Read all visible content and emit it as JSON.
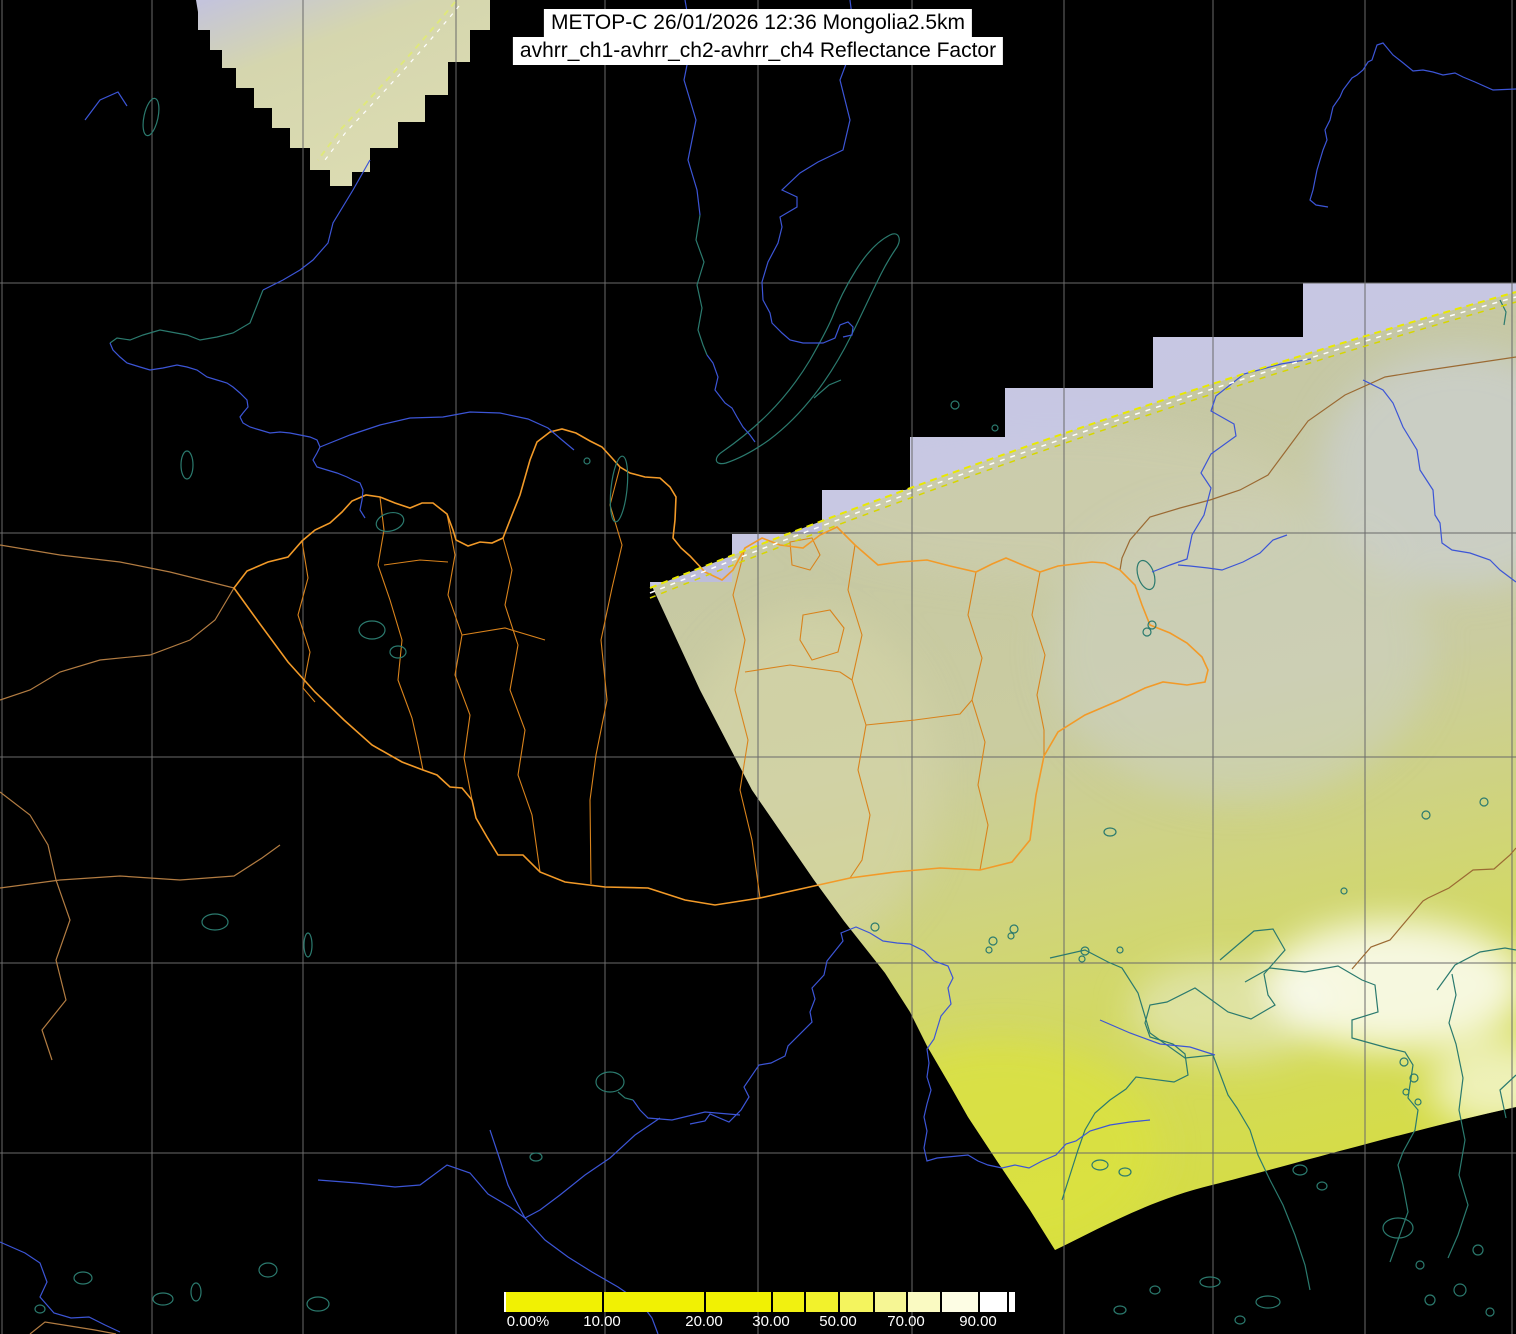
{
  "title": {
    "line1": "METOP-C 26/01/2026 12:36 Mongolia2.5km",
    "line2": "avhrr_ch1-avhrr_ch2-avhrr_ch4 Reflectance Factor"
  },
  "colorbar": {
    "unit": "%",
    "scale": "nonlinear",
    "labels": [
      {
        "text": "0.00%",
        "value": 0
      },
      {
        "text": "10.00",
        "value": 10
      },
      {
        "text": "20.00",
        "value": 20
      },
      {
        "text": "30.00",
        "value": 30
      },
      {
        "text": "50.00",
        "value": 50
      },
      {
        "text": "70.00",
        "value": 70
      },
      {
        "text": "90.00",
        "value": 90
      }
    ],
    "tick_values": [
      10,
      20,
      30,
      40,
      50,
      60,
      70,
      80,
      90
    ],
    "color_low": "#f1f103",
    "color_high": "#ffffff"
  },
  "map_colors": {
    "background": "#000000",
    "graticule": "#6a6a6a",
    "country_border": "#f29a28",
    "admin_border": "#d9831c",
    "west_border": "#b27c42",
    "russia_china_border": "#9b6a33",
    "river": "#3c55d6",
    "coast_lake": "#2b7a6e",
    "swath_edge_dash": "#e9e900",
    "swath_lavender": "#c7c7e6"
  }
}
